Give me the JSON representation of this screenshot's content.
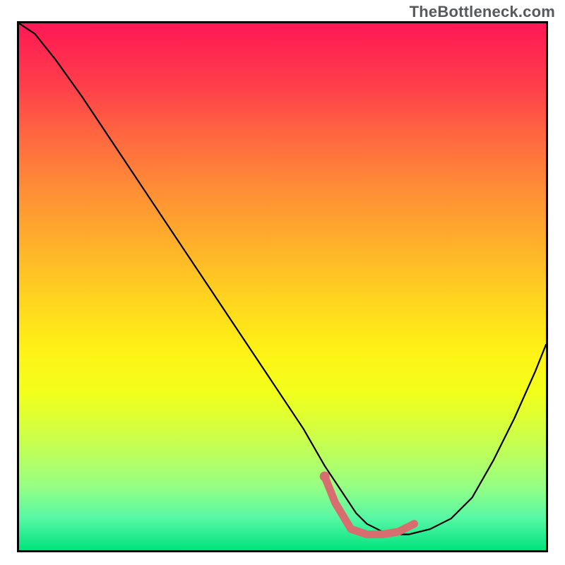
{
  "watermark": "TheBottleneck.com",
  "chart_data": {
    "type": "line",
    "title": "",
    "xlabel": "",
    "ylabel": "",
    "xlim": [
      0,
      100
    ],
    "ylim": [
      0,
      100
    ],
    "grid": false,
    "legend": false,
    "background_gradient": {
      "direction": "vertical",
      "stops": [
        {
          "pos": 0.0,
          "color": "#ff1855"
        },
        {
          "pos": 0.62,
          "color": "#fff215"
        },
        {
          "pos": 1.0,
          "color": "#00e37d"
        }
      ]
    },
    "series": [
      {
        "name": "main-curve",
        "color": "#000000",
        "x": [
          0,
          3,
          7,
          12,
          18,
          24,
          30,
          36,
          42,
          48,
          54,
          58,
          62,
          64,
          66,
          68,
          70,
          74,
          78,
          82,
          86,
          90,
          94,
          98,
          100
        ],
        "y": [
          100,
          98,
          93,
          86,
          77,
          68,
          59,
          50,
          41,
          32,
          23,
          16,
          10,
          7,
          5,
          4,
          3,
          3,
          4,
          6,
          10,
          17,
          25,
          34,
          39
        ]
      },
      {
        "name": "accent-segment",
        "color": "#d86d6f",
        "x": [
          58,
          60,
          63,
          66,
          69,
          72,
          75
        ],
        "y": [
          14,
          9,
          4,
          3,
          3,
          3.5,
          5
        ]
      }
    ],
    "markers": [
      {
        "name": "accent-dot-start",
        "x": 58,
        "y": 14,
        "color": "#d86d6f"
      }
    ]
  }
}
